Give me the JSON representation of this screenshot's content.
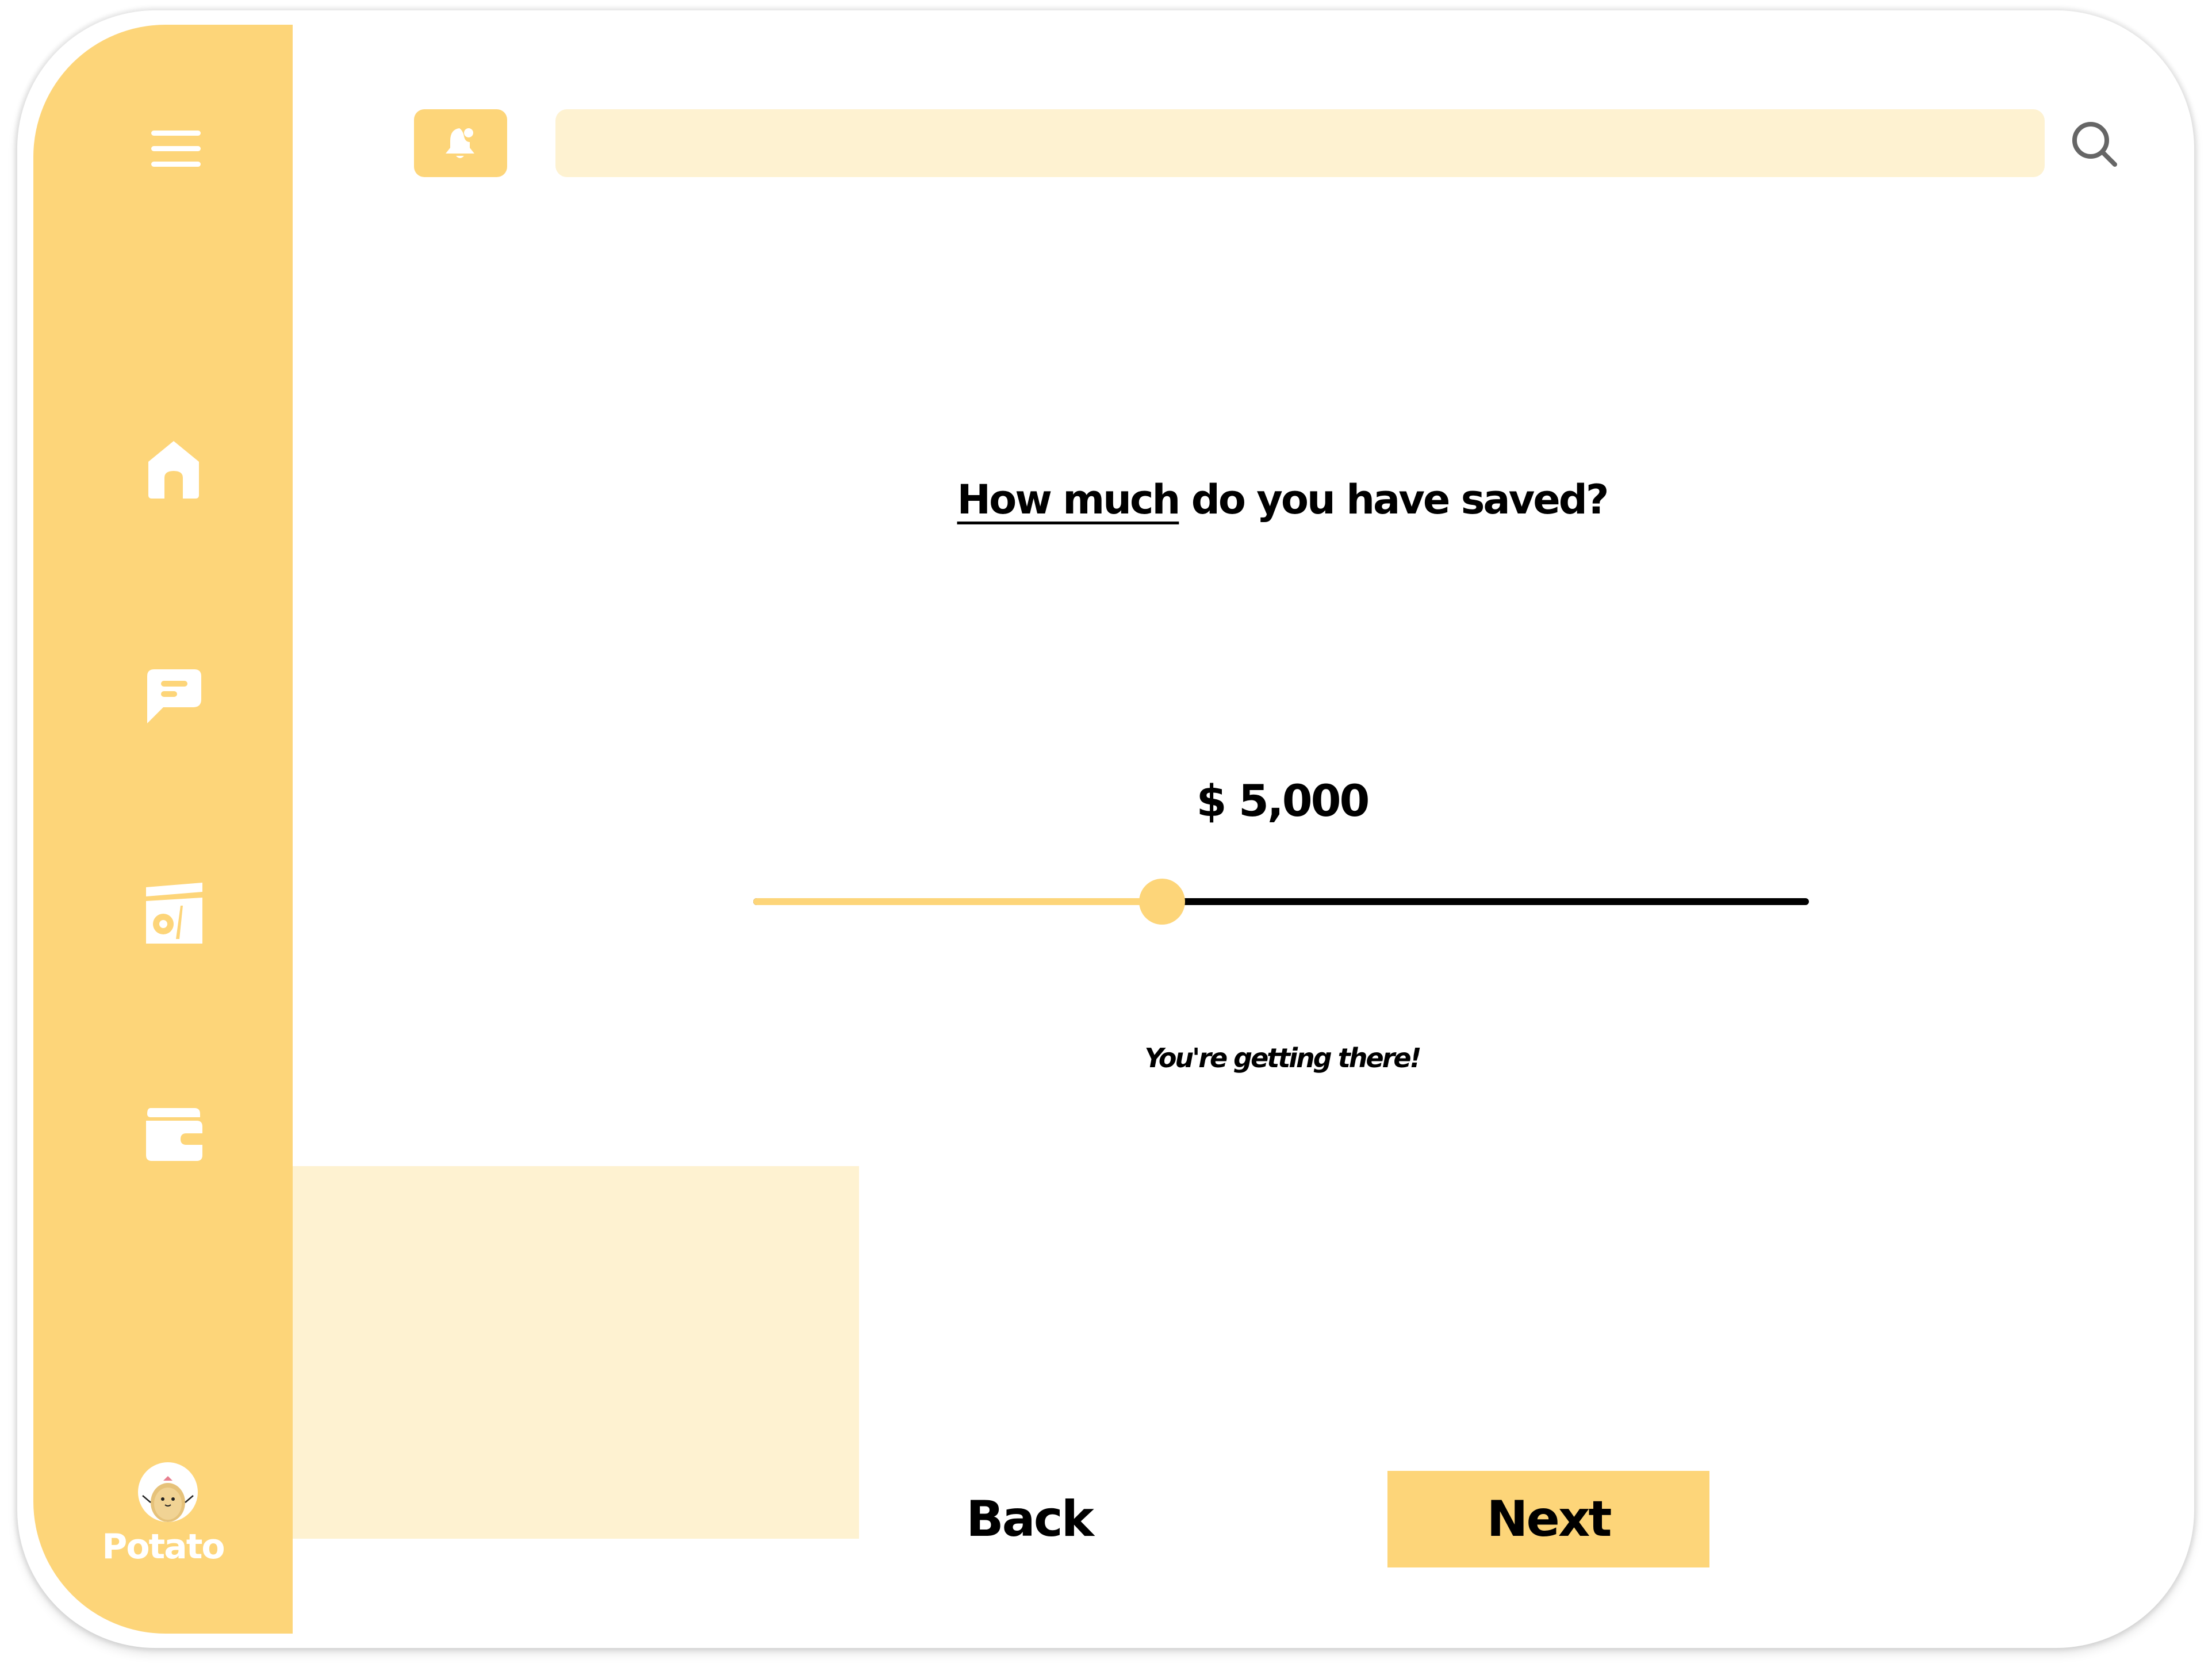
{
  "app": {
    "accent_color": "#fdd579",
    "accent_light_color": "#fef2d1"
  },
  "sidebar": {
    "items": [
      {
        "icon": "menu-icon"
      },
      {
        "icon": "home-icon"
      },
      {
        "icon": "chat-icon"
      },
      {
        "icon": "savings-icon"
      },
      {
        "icon": "wallet-icon"
      }
    ],
    "profile": {
      "name": "Potato",
      "avatar_icon": "potato-avatar-icon"
    }
  },
  "header": {
    "notification_icon": "bell-icon",
    "search": {
      "value": "",
      "placeholder": ""
    },
    "search_icon": "search-icon"
  },
  "main": {
    "question_emphasis": "How much",
    "question_rest": " do you have saved?",
    "amount": "$ 5,000",
    "slider": {
      "level": 0.387
    },
    "encouragement": "You're getting there!",
    "back_label": "Back",
    "next_label": "Next"
  }
}
